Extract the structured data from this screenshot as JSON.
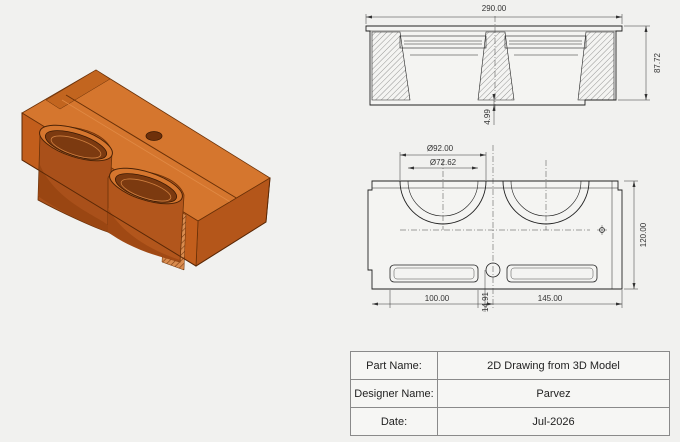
{
  "dimensions": {
    "overall_width": "290.00",
    "overall_height": "87.72",
    "base_thickness": "4.99",
    "bore_outer": "Ø92.00",
    "bore_inner": "Ø72.62",
    "depth": "120.00",
    "left_offset": "100.00",
    "right_offset": "145.00",
    "hole_offset": "14.91"
  },
  "title_block": {
    "rows": [
      {
        "label": "Part Name:",
        "value": "2D Drawing from 3D Model"
      },
      {
        "label": "Designer Name:",
        "value": "Parvez"
      },
      {
        "label": "Date:",
        "value": "Jul-2026"
      }
    ]
  },
  "colors": {
    "body": "#c8651d",
    "body_dark": "#9e4a12",
    "body_light": "#d97a30",
    "line": "#222222"
  }
}
